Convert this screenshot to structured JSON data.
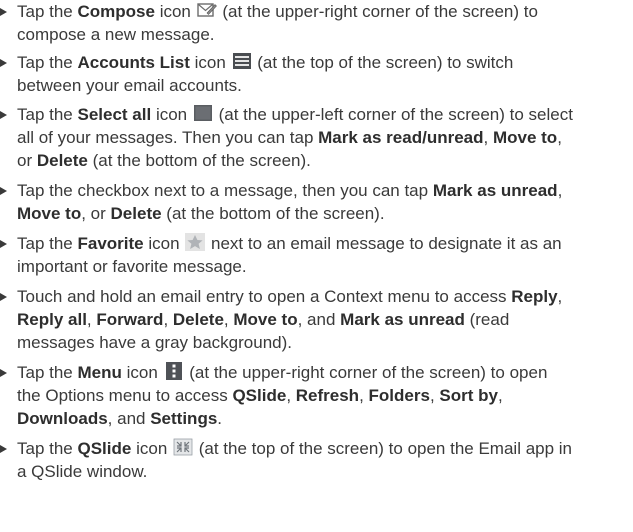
{
  "items": [
    {
      "lines": [
        [
          "Tap the ",
          {
            "b": "Compose"
          },
          " icon ",
          {
            "icon": "compose-icon"
          },
          " (at the upper-right corner of the screen) to"
        ],
        [
          "compose a new message."
        ]
      ]
    },
    {
      "lines": [
        [
          "Tap the ",
          {
            "b": "Accounts List"
          },
          " icon ",
          {
            "icon": "accounts-list-icon"
          },
          " (at the top of the screen) to switch"
        ],
        [
          "between your email accounts."
        ]
      ]
    },
    {
      "lines": [
        [
          "Tap the ",
          {
            "b": "Select all"
          },
          " icon ",
          {
            "icon": "select-all-icon"
          },
          " (at the upper-left corner of the screen) to select"
        ],
        [
          "all of your messages. Then you can tap ",
          {
            "b": "Mark as read/unread"
          },
          ", ",
          {
            "b": "Move to"
          },
          ","
        ],
        [
          "or ",
          {
            "b": "Delete"
          },
          " (at the bottom of the screen)."
        ]
      ]
    },
    {
      "lines": [
        [
          "Tap the checkbox next to a message, then you can tap ",
          {
            "b": "Mark as unread"
          },
          ","
        ],
        [
          {
            "b": "Move to"
          },
          ", or ",
          {
            "b": "Delete"
          },
          " (at the bottom of the screen)."
        ]
      ]
    },
    {
      "lines": [
        [
          "Tap the ",
          {
            "b": "Favorite"
          },
          " icon ",
          {
            "icon": "favorite-star-icon"
          },
          " next to an email message to designate it as an"
        ],
        [
          "important or favorite message."
        ]
      ]
    },
    {
      "lines": [
        [
          "Touch and hold an email entry to open a Context menu to access ",
          {
            "b": "Reply"
          },
          ","
        ],
        [
          {
            "b": "Reply all"
          },
          ", ",
          {
            "b": "Forward"
          },
          ", ",
          {
            "b": "Delete"
          },
          ", ",
          {
            "b": "Move to"
          },
          ", and ",
          {
            "b": "Mark as unread"
          },
          " (read"
        ],
        [
          "messages have a gray background)."
        ]
      ]
    },
    {
      "lines": [
        [
          "Tap the ",
          {
            "b": "Menu"
          },
          " icon ",
          {
            "icon": "menu-icon"
          },
          " (at the upper-right corner of the screen) to open"
        ],
        [
          "the Options menu to access ",
          {
            "b": "QSlide"
          },
          ", ",
          {
            "b": "Refresh"
          },
          ", ",
          {
            "b": "Folders"
          },
          ", ",
          {
            "b": "Sort by"
          },
          ","
        ],
        [
          {
            "b": "Downloads"
          },
          ", and ",
          {
            "b": "Settings"
          },
          "."
        ]
      ]
    },
    {
      "lines": [
        [
          "Tap the ",
          {
            "b": "QSlide"
          },
          " icon ",
          {
            "icon": "qslide-icon"
          },
          " (at the top of the screen) to open the Email app in"
        ],
        [
          "a QSlide window."
        ]
      ]
    }
  ]
}
